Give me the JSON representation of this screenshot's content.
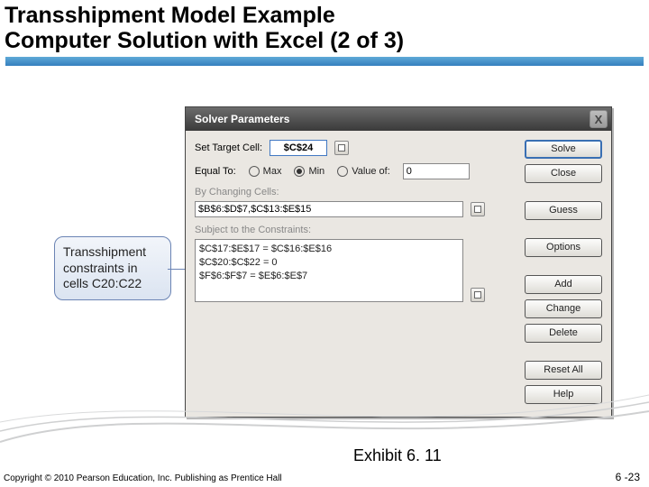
{
  "slide": {
    "title_line1": "Transshipment Model Example",
    "title_line2": "Computer Solution with Excel (2 of 3)",
    "exhibit": "Exhibit 6. 11",
    "copyright": "Copyright © 2010 Pearson Education, Inc. Publishing as Prentice Hall",
    "page": "6 -23"
  },
  "callout": {
    "text": "Transshipment constraints in cells C20:C22"
  },
  "dialog": {
    "title": "Solver Parameters",
    "close": "X",
    "set_target_label": "Set Target Cell:",
    "target_cell": "$C$24",
    "equal_to_label": "Equal To:",
    "opt_max": "Max",
    "opt_min": "Min",
    "opt_value_of": "Value of:",
    "value_of_input": "0",
    "by_changing_label": "By Changing Cells:",
    "changing_cells": "$B$6:$D$7,$C$13:$E$15",
    "subject_label": "Subject to the Constraints:",
    "constraints": [
      "$C$17:$E$17 = $C$16:$E$16",
      "$C$20:$C$22 = 0",
      "$F$6:$F$7 = $E$6:$E$7"
    ],
    "buttons": {
      "solve": "Solve",
      "close": "Close",
      "guess": "Guess",
      "options": "Options",
      "add": "Add",
      "change": "Change",
      "delete": "Delete",
      "reset": "Reset All",
      "help": "Help"
    }
  }
}
